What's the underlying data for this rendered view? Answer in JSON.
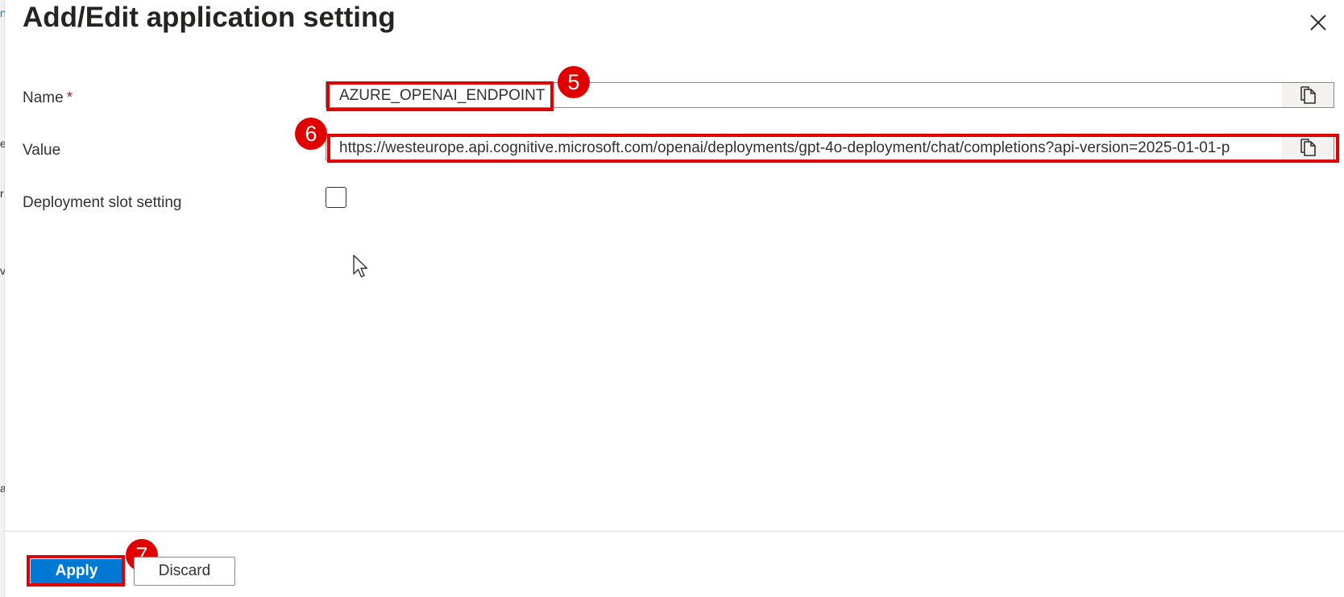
{
  "panel": {
    "title": "Add/Edit application setting"
  },
  "form": {
    "name": {
      "label": "Name",
      "required_marker": "*",
      "value": "AZURE_OPENAI_ENDPOINT"
    },
    "value": {
      "label": "Value",
      "value": "https://westeurope.api.cognitive.microsoft.com/openai/deployments/gpt-4o-deployment/chat/completions?api-version=2025-01-01-p"
    },
    "deployment_slot": {
      "label": "Deployment slot setting",
      "checked": false
    }
  },
  "footer": {
    "apply_label": "Apply",
    "discard_label": "Discard"
  },
  "annotations": {
    "step_name": "5",
    "step_value": "6",
    "step_apply": "7"
  },
  "background_fragments": [
    "n",
    "e",
    "r",
    "v",
    "a"
  ],
  "colors": {
    "accent": "#0078d4",
    "highlight": "#e00000",
    "required": "#a4262c"
  },
  "icons": {
    "close": "close-icon",
    "copy": "copy-icon",
    "cursor": "mouse-cursor-icon"
  }
}
